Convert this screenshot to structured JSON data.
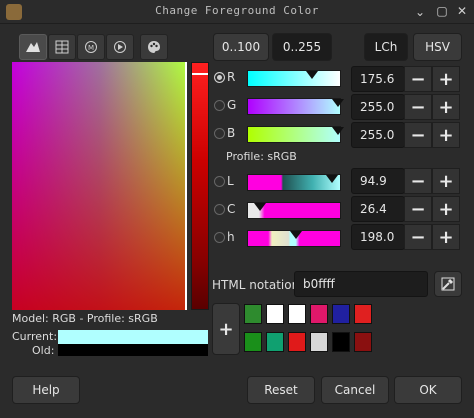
{
  "window": {
    "title": "Change Foreground Color"
  },
  "selector_tabs": [
    {
      "name": "gimp-selector-icon"
    },
    {
      "name": "cmyk-selector-icon"
    },
    {
      "name": "watercolor-selector-icon"
    },
    {
      "name": "wheel-selector-icon"
    },
    {
      "name": "palette-selector-icon"
    }
  ],
  "range_buttons": {
    "r0_100": "0..100",
    "r0_255": "0..255"
  },
  "mode_buttons": {
    "lch": "LCh",
    "hsv": "HSV"
  },
  "channels": {
    "rgb": [
      {
        "label": "R",
        "value": "175.6",
        "checked": true
      },
      {
        "label": "G",
        "value": "255.0",
        "checked": false
      },
      {
        "label": "B",
        "value": "255.0",
        "checked": false
      }
    ],
    "lch": [
      {
        "label": "L",
        "value": "94.9",
        "checked": false
      },
      {
        "label": "C",
        "value": "26.4",
        "checked": false
      },
      {
        "label": "h",
        "value": "198.0",
        "checked": false
      }
    ]
  },
  "profile_label": "Profile: sRGB",
  "model_label": "Model: RGB - Profile: sRGB",
  "current_label": "Current:",
  "old_label": "Old:",
  "html_notation": {
    "label": "HTML notation:",
    "value": "b0ffff"
  },
  "history_swatches": [
    "#2e8b2e",
    "#ffffff",
    "#ffffff",
    "#e0186a",
    "#2020a0",
    "#e02020",
    "#1a8f1a",
    "#10a070",
    "#e01a1a",
    "#d8d8d8",
    "#000000",
    "#8a1010"
  ],
  "colors": {
    "current": "#b0ffff",
    "old": "#000000"
  },
  "buttons": {
    "help": "Help",
    "reset": "Reset",
    "cancel": "Cancel",
    "ok": "OK"
  },
  "icons": {
    "add": "+",
    "minus": "−",
    "plus": "+"
  }
}
